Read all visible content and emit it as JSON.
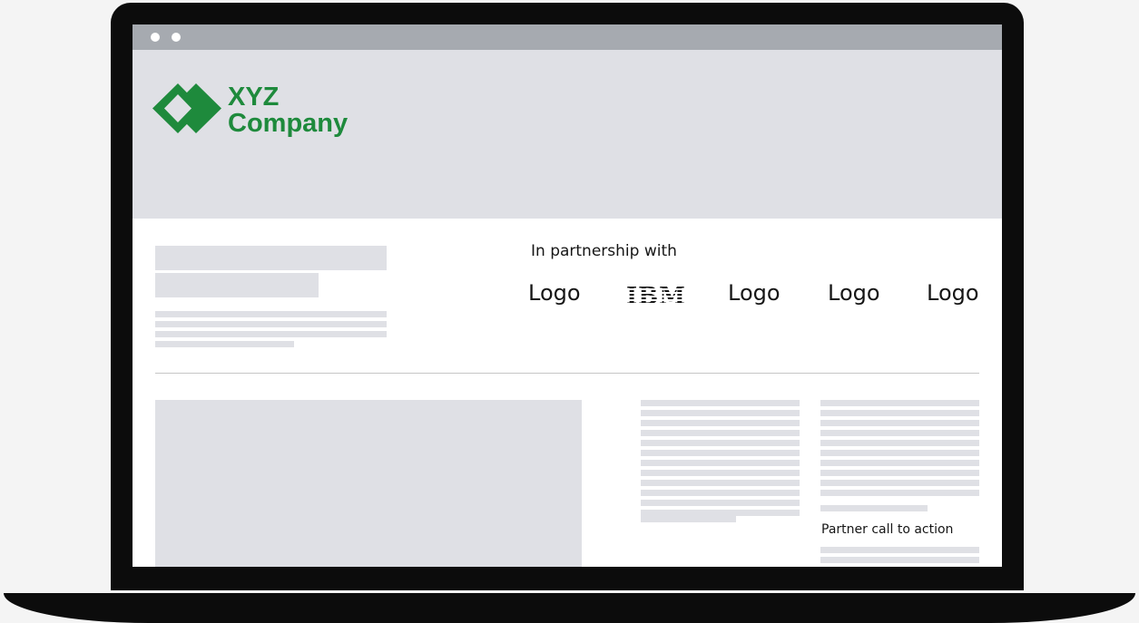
{
  "hero": {
    "brand": {
      "line1": "XYZ",
      "line2": "Company",
      "color": "#1e8a3c"
    }
  },
  "partners": {
    "heading": "In partnership with",
    "logos": [
      "Logo",
      "IBM",
      "Logo",
      "Logo",
      "Logo"
    ]
  },
  "content": {
    "cta_label": "Partner call to action"
  },
  "colors": {
    "placeholder": "#dfe0e5",
    "browser_bar": "#a6aab0",
    "bezel": "#0c0c0c",
    "brand_green": "#1e8a3c"
  }
}
